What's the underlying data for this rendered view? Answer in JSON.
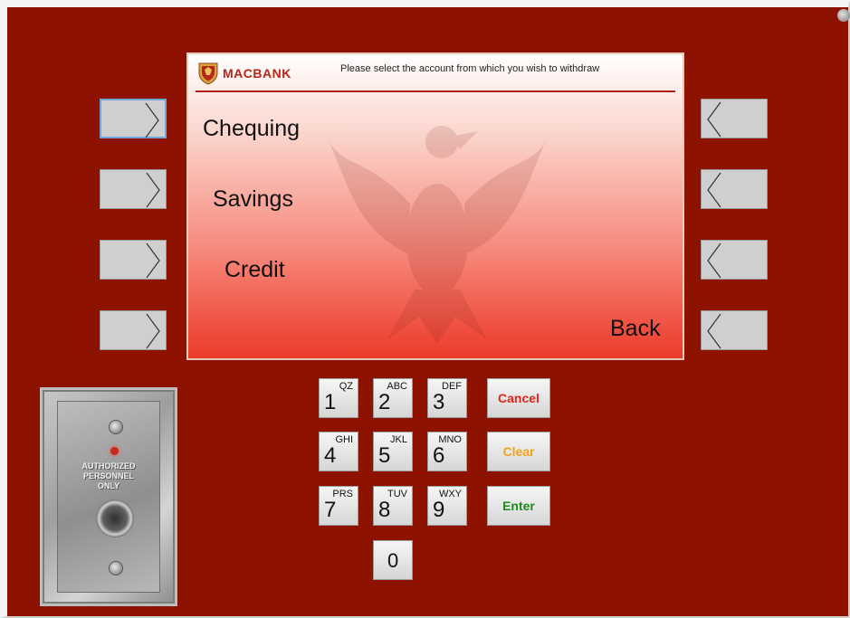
{
  "screen": {
    "brand": "MACBANK",
    "prompt": "Please select the account from which you wish to withdraw",
    "options": [
      "Chequing",
      "Savings",
      "Credit"
    ],
    "back_label": "Back"
  },
  "keypad": {
    "keys": [
      {
        "digit": "1",
        "letters": "QZ"
      },
      {
        "digit": "2",
        "letters": "ABC"
      },
      {
        "digit": "3",
        "letters": "DEF"
      },
      {
        "digit": "4",
        "letters": "GHI"
      },
      {
        "digit": "5",
        "letters": "JKL"
      },
      {
        "digit": "6",
        "letters": "MNO"
      },
      {
        "digit": "7",
        "letters": "PRS"
      },
      {
        "digit": "8",
        "letters": "TUV"
      },
      {
        "digit": "9",
        "letters": "WXY"
      },
      {
        "digit": "0",
        "letters": ""
      }
    ],
    "cancel_label": "Cancel",
    "clear_label": "Clear",
    "enter_label": "Enter"
  },
  "plate": {
    "line1": "AUTHORIZED",
    "line2": "PERSONNEL",
    "line3": "ONLY"
  },
  "colors": {
    "panel": "#8e1200",
    "cancel": "#e4251b",
    "clear": "#f2a21a",
    "enter": "#1e8a1e"
  }
}
